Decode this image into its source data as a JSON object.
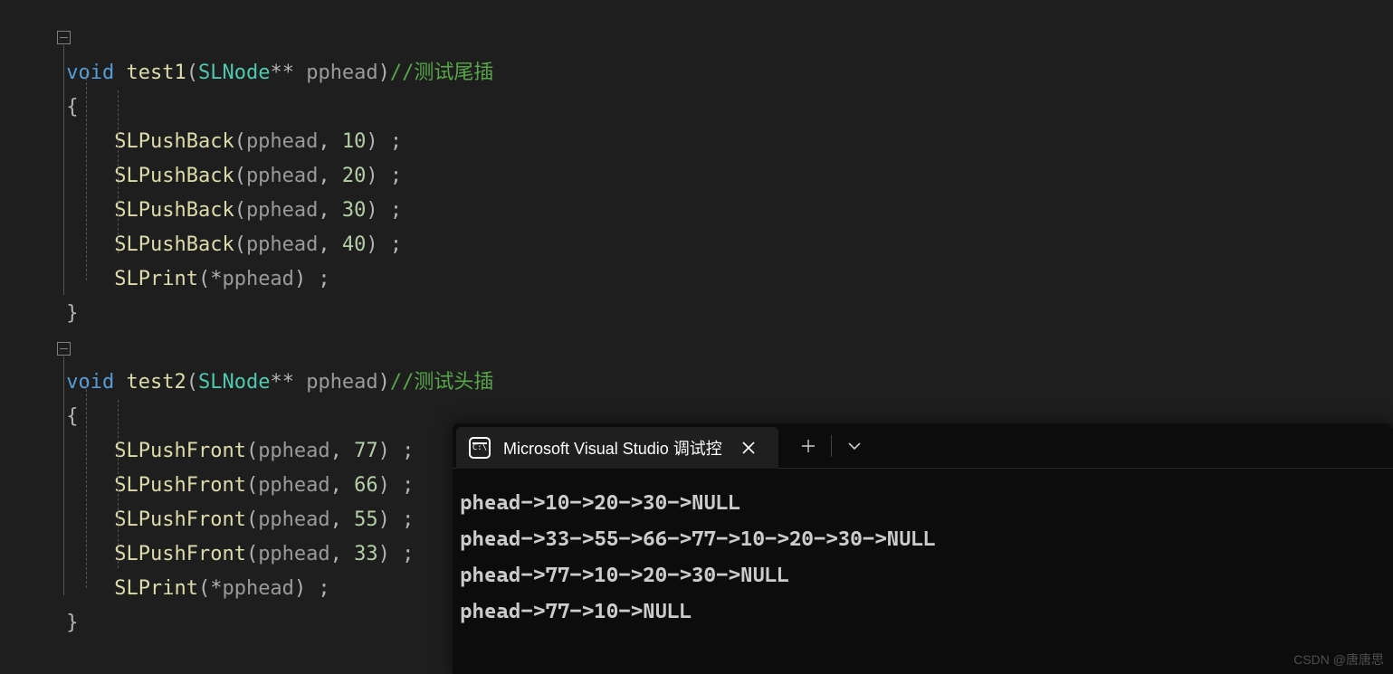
{
  "code": {
    "fn1": {
      "ret": "void",
      "name": "test1",
      "paramType": "SLNode",
      "stars": "**",
      "paramName": " pphead",
      "comment": "//测试尾插",
      "lines": [
        {
          "fn": "SLPushBack",
          "args_open": "(",
          "arg1": "pphead",
          "comma": ", ",
          "val": "10",
          "args_close": ") ;"
        },
        {
          "fn": "SLPushBack",
          "args_open": "(",
          "arg1": "pphead",
          "comma": ", ",
          "val": "20",
          "args_close": ") ;"
        },
        {
          "fn": "SLPushBack",
          "args_open": "(",
          "arg1": "pphead",
          "comma": ", ",
          "val": "30",
          "args_close": ") ;"
        },
        {
          "fn": "SLPushBack",
          "args_open": "(",
          "arg1": "pphead",
          "comma": ", ",
          "val": "40",
          "args_close": ") ;"
        },
        {
          "fn": "SLPrint",
          "args_open": "(",
          "star": "*",
          "arg1": "pphead",
          "args_close": ") ;"
        }
      ]
    },
    "fn2": {
      "ret": "void",
      "name": "test2",
      "paramType": "SLNode",
      "stars": "**",
      "paramName": " pphead",
      "comment": "//测试头插",
      "lines": [
        {
          "fn": "SLPushFront",
          "args_open": "(",
          "arg1": "pphead",
          "comma": ", ",
          "val": "77",
          "args_close": ") ;"
        },
        {
          "fn": "SLPushFront",
          "args_open": "(",
          "arg1": "pphead",
          "comma": ", ",
          "val": "66",
          "args_close": ") ;"
        },
        {
          "fn": "SLPushFront",
          "args_open": "(",
          "arg1": "pphead",
          "comma": ", ",
          "val": "55",
          "args_close": ") ;"
        },
        {
          "fn": "SLPushFront",
          "args_open": "(",
          "arg1": "pphead",
          "comma": ", ",
          "val": "33",
          "args_close": ") ;"
        },
        {
          "fn": "SLPrint",
          "args_open": "(",
          "star": "*",
          "arg1": "pphead",
          "args_close": ") ;"
        }
      ]
    },
    "brace_open": "{",
    "brace_close": "}",
    "paren_open": "(",
    "paren_close": ")"
  },
  "console": {
    "tab_title": "Microsoft Visual Studio 调试控",
    "output": [
      "phead->10->20->30->NULL",
      "phead->33->55->66->77->10->20->30->NULL",
      "phead->77->10->20->30->NULL",
      "phead->77->10->NULL"
    ]
  },
  "watermark": "CSDN @唐唐思"
}
